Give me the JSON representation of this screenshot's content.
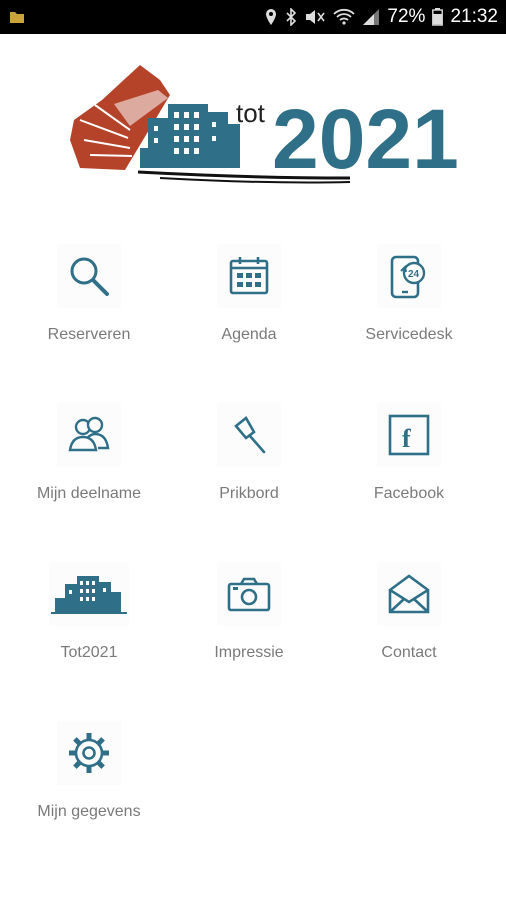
{
  "status_bar": {
    "battery": "72%",
    "time": "21:32",
    "icons": [
      "notification-folder-icon",
      "location-icon",
      "bluetooth-icon",
      "mute-icon",
      "wifi-icon",
      "signal-icon",
      "battery-icon"
    ]
  },
  "logo": {
    "text_small": "tot",
    "text_large": "2021",
    "colors": {
      "accent_red": "#b4432a",
      "brand_blue": "#2f6f88"
    }
  },
  "menu": {
    "items": [
      {
        "label": "Reserveren",
        "icon": "search-icon"
      },
      {
        "label": "Agenda",
        "icon": "calendar-icon"
      },
      {
        "label": "Servicedesk",
        "icon": "servicedesk-24-icon"
      },
      {
        "label": "Mijn deelname",
        "icon": "users-icon"
      },
      {
        "label": "Prikbord",
        "icon": "pushpin-icon"
      },
      {
        "label": "Facebook",
        "icon": "facebook-icon"
      },
      {
        "label": "Tot2021",
        "icon": "building-icon"
      },
      {
        "label": "Impressie",
        "icon": "camera-icon"
      },
      {
        "label": "Contact",
        "icon": "envelope-icon"
      },
      {
        "label": "Mijn gegevens",
        "icon": "gear-icon"
      }
    ]
  }
}
